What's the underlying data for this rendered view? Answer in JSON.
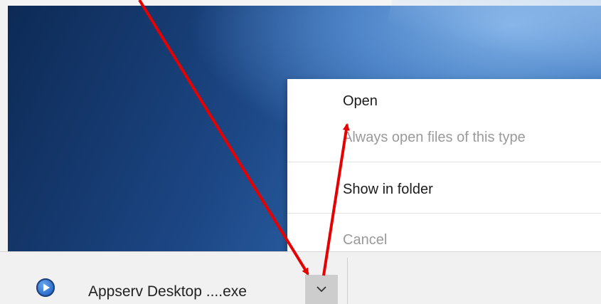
{
  "context_menu": {
    "items": [
      {
        "label": "Open",
        "enabled": true
      },
      {
        "label": "Always open files of this type",
        "enabled": false
      },
      {
        "label": "Show in folder",
        "enabled": true
      },
      {
        "label": "Cancel",
        "enabled": false
      }
    ]
  },
  "downloads_shelf": {
    "file_name": "Appserv Desktop ....exe",
    "file_icon": "play-circle-icon",
    "menu_button_icon": "chevron-down-icon"
  },
  "annotation": {
    "arrow_color": "#e60000"
  },
  "colors": {
    "desktop": "#1c4684",
    "menu_background": "#ffffff",
    "disabled_text": "#9a9a9a",
    "shelf_background": "#f1f1f1",
    "chevron_button_active": "#cdcdcd"
  }
}
